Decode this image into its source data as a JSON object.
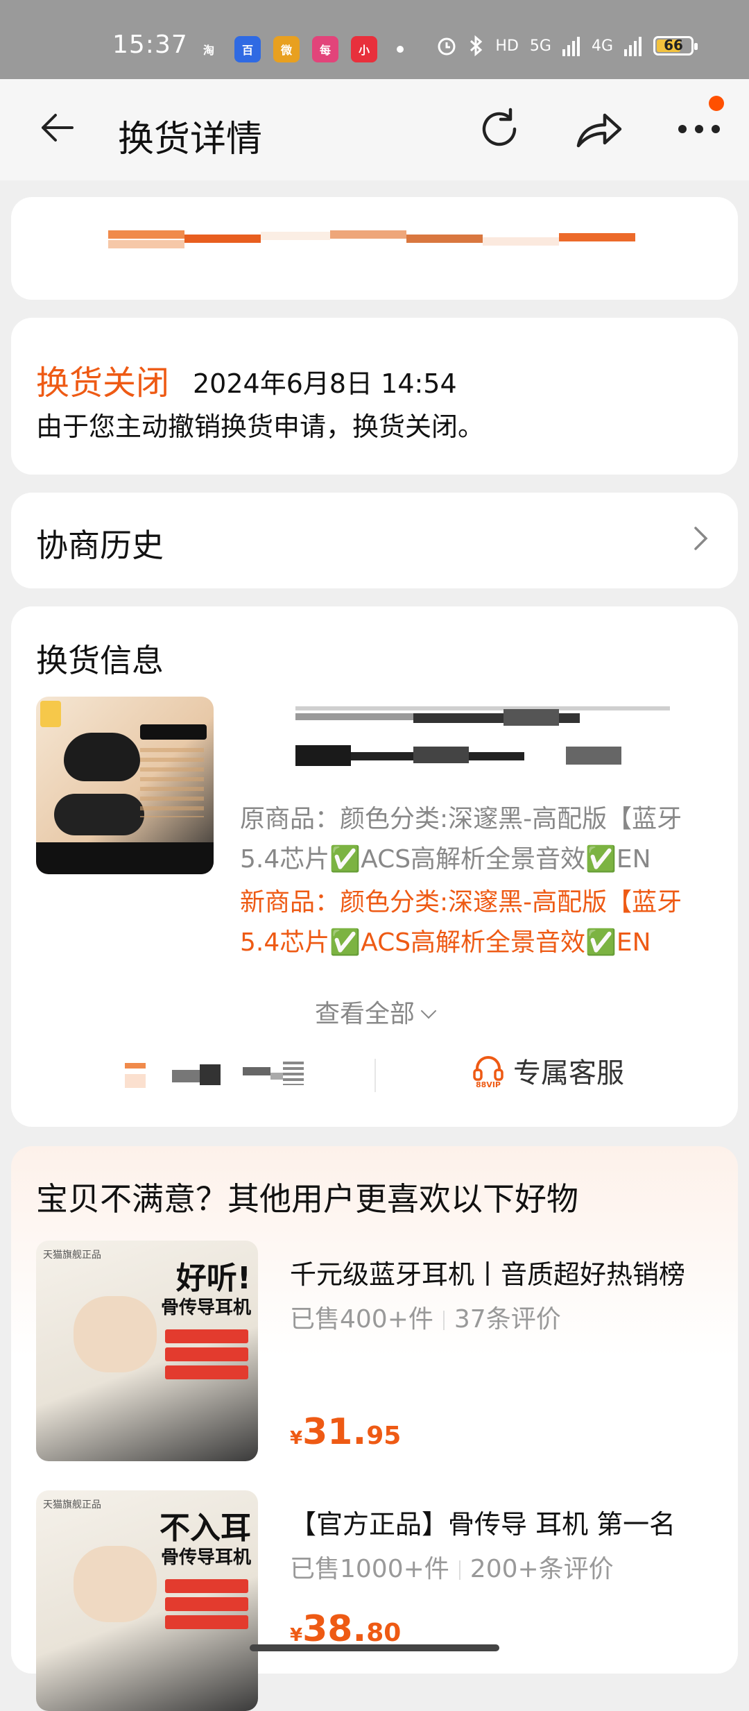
{
  "status_bar": {
    "time": "15:37",
    "apps": [
      {
        "label": "淘",
        "color": "#9a9a9a"
      },
      {
        "label": "百",
        "color": "#2f6ae3"
      },
      {
        "label": "微",
        "color": "#e8a020"
      },
      {
        "label": "每",
        "color": "#e2447a"
      },
      {
        "label": "小",
        "color": "#e8303c"
      }
    ],
    "network": "HD",
    "signal_1": "5G",
    "signal_2": "4G",
    "battery": "66"
  },
  "navbar": {
    "title": "换货详情"
  },
  "status": {
    "title": "换货关闭",
    "time": "2024年6月8日 14:54",
    "description": "由于您主动撤销换货申请，换货关闭。"
  },
  "history": {
    "label": "协商历史"
  },
  "exchange": {
    "title": "换货信息",
    "original": "原商品：颜色分类:深邃黑-高配版【蓝牙5.4芯片✅ACS高解析全景音效✅EN",
    "new": "新商品：颜色分类:深邃黑-高配版【蓝牙5.4芯片✅ACS高解析全景音效✅EN",
    "view_all": "查看全部",
    "service_label": "专属客服",
    "service_badge": "88VIP"
  },
  "recommend": {
    "title": "宝贝不满意？其他用户更喜欢以下好物",
    "items": [
      {
        "name": "千元级蓝牙耳机丨音质超好热销榜",
        "sold": "已售400+件",
        "reviews": "37条评价",
        "currency": "¥",
        "price_int": "31.",
        "price_dec": "95",
        "img_big": "好听!",
        "img_sub": "骨传导耳机",
        "img_shop": "天猫旗舰正品"
      },
      {
        "name": "【官方正品】骨传导 耳机 第一名",
        "sold": "已售1000+件",
        "reviews": "200+条评价",
        "currency": "¥",
        "price_int": "38.",
        "price_dec": "80",
        "img_big": "不入耳",
        "img_sub": "骨传导耳机",
        "img_shop": "天猫旗舰正品"
      }
    ]
  },
  "colors": {
    "accent": "#ee5a14",
    "status_bar_bg": "#9a9a9a"
  }
}
